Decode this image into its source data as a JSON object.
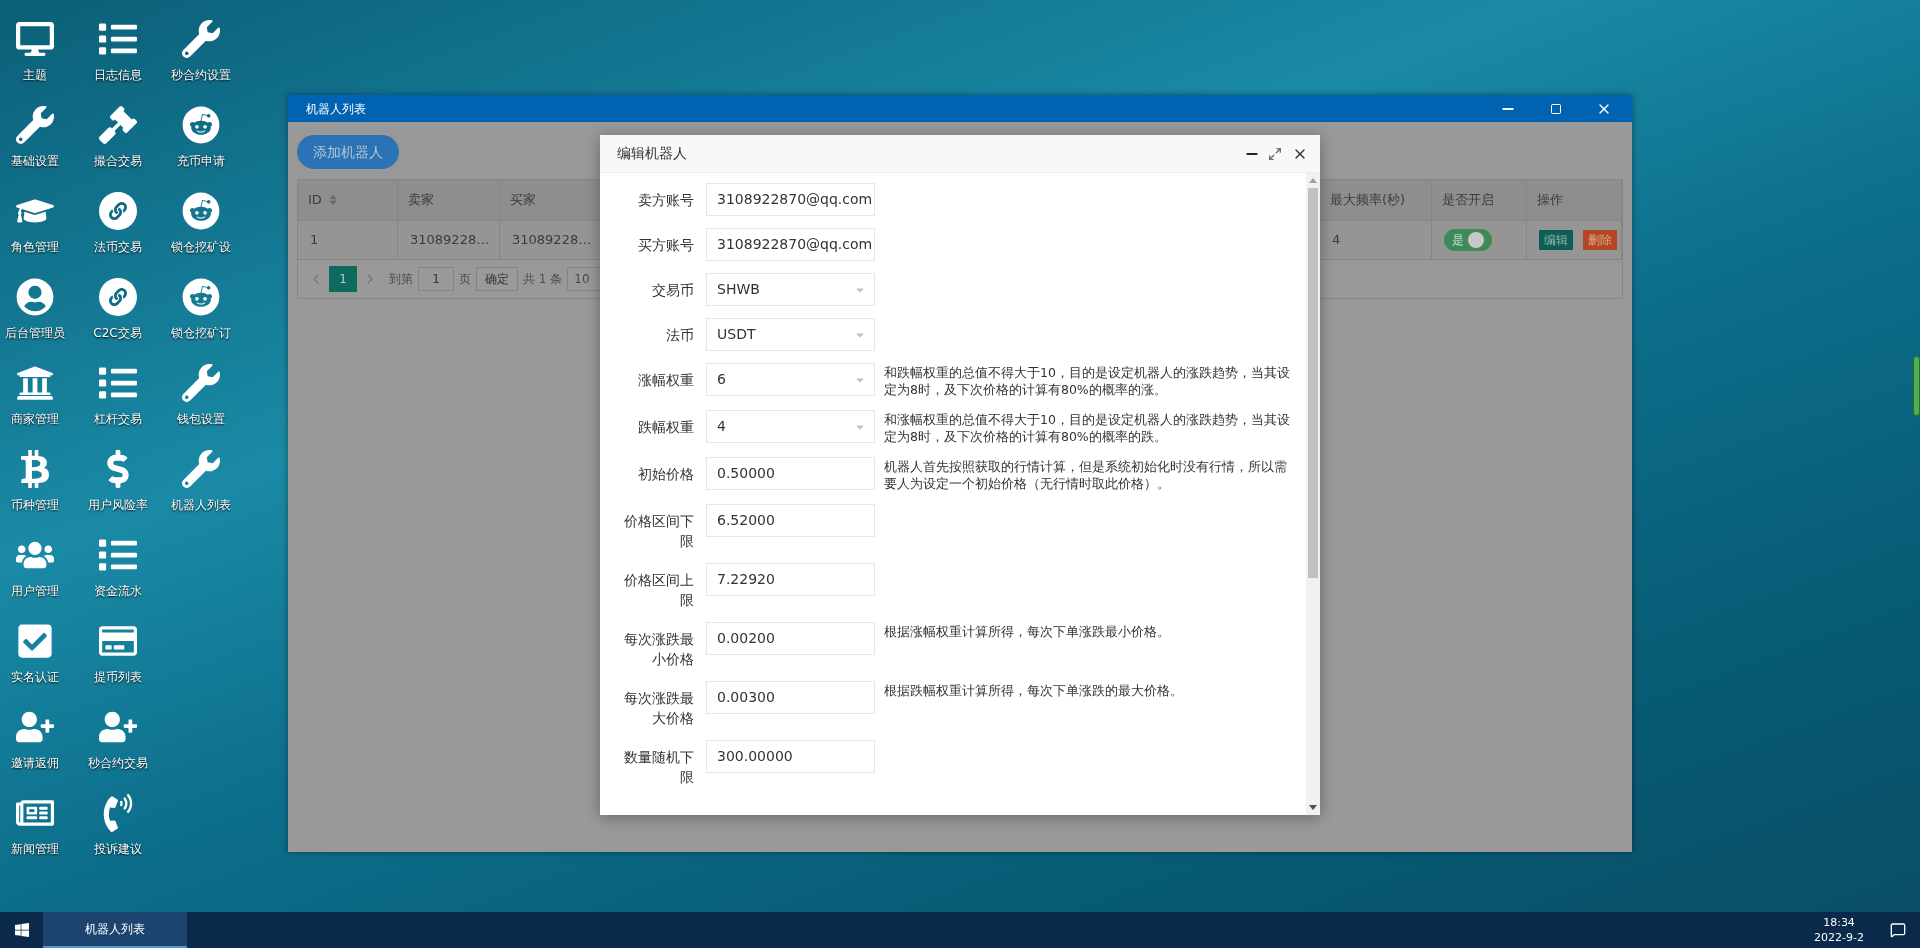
{
  "desktop": {
    "icon_columns": [
      [
        {
          "label": "主题",
          "kind": "monitor"
        },
        {
          "label": "基础设置",
          "kind": "wrench"
        },
        {
          "label": "角色管理",
          "kind": "cap"
        },
        {
          "label": "后台管理员",
          "kind": "user"
        },
        {
          "label": "商家管理",
          "kind": "bank"
        },
        {
          "label": "币种管理",
          "kind": "bitcoin"
        },
        {
          "label": "用户管理",
          "kind": "users"
        },
        {
          "label": "实名认证",
          "kind": "check"
        },
        {
          "label": "邀请返佣",
          "kind": "adduser"
        },
        {
          "label": "新闻管理",
          "kind": "news"
        }
      ],
      [
        {
          "label": "日志信息",
          "kind": "list"
        },
        {
          "label": "撮合交易",
          "kind": "gavel"
        },
        {
          "label": "法币交易",
          "kind": "link"
        },
        {
          "label": "C2C交易",
          "kind": "link"
        },
        {
          "label": "杠杆交易",
          "kind": "list"
        },
        {
          "label": "用户风险率",
          "kind": "dollar"
        },
        {
          "label": "资金流水",
          "kind": "list"
        },
        {
          "label": "提币列表",
          "kind": "card"
        },
        {
          "label": "秒合约交易",
          "kind": "adduser"
        },
        {
          "label": "投诉建议",
          "kind": "phone"
        }
      ],
      [
        {
          "label": "秒合约设置",
          "kind": "wrench"
        },
        {
          "label": "充币申请",
          "kind": "alien"
        },
        {
          "label": "锁仓挖矿设",
          "kind": "alien"
        },
        {
          "label": "锁仓挖矿订",
          "kind": "alien"
        },
        {
          "label": "钱包设置",
          "kind": "wrench"
        },
        {
          "label": "机器人列表",
          "kind": "wrench"
        }
      ]
    ]
  },
  "window": {
    "title": "机器人列表",
    "add_button": "添加机器人",
    "table": {
      "columns": [
        {
          "label": "ID",
          "sortable": true
        },
        {
          "label": "卖家",
          "sortable": false
        },
        {
          "label": "买家",
          "sortable": false
        },
        {
          "label": "最大频率(秒)",
          "sortable": false
        },
        {
          "label": "是否开启",
          "sortable": false
        },
        {
          "label": "操作",
          "sortable": false
        }
      ],
      "rows": [
        {
          "cells": [
            {
              "kind": "text",
              "text": "1"
            },
            {
              "kind": "text",
              "text": "31089228…"
            },
            {
              "kind": "text",
              "text": "31089228…"
            },
            {
              "kind": "text",
              "text": "4"
            },
            {
              "kind": "toggle",
              "label": "是",
              "on": true
            },
            {
              "kind": "actions",
              "buttons": [
                {
                  "label": "编辑",
                  "kind": "edit"
                },
                {
                  "label": "删除",
                  "kind": "delete"
                }
              ]
            }
          ]
        }
      ]
    },
    "pagination": {
      "pages": [
        {
          "label": "1",
          "selected": true
        }
      ],
      "goto_label": "到第",
      "goto_value": "1",
      "page_unit": "页",
      "confirm": "确定",
      "total": "共 1 条",
      "page_size": "10"
    }
  },
  "dialog": {
    "title": "编辑机器人",
    "fields": [
      {
        "label": "卖方账号",
        "kind": "input",
        "value": "3108922870@qq.com"
      },
      {
        "label": "买方账号",
        "kind": "input",
        "value": "3108922870@qq.com"
      },
      {
        "label": "交易币",
        "kind": "select",
        "value": "SHWB"
      },
      {
        "label": "法币",
        "kind": "select",
        "value": "USDT"
      },
      {
        "label": "涨幅权重",
        "kind": "select",
        "value": "6",
        "help": "和跌幅权重的总值不得大于10，目的是设定机器人的涨跌趋势，当其设定为8时，及下次价格的计算有80%的概率的涨。"
      },
      {
        "label": "跌幅权重",
        "kind": "select",
        "value": "4",
        "help": "和涨幅权重的总值不得大于10，目的是设定机器人的涨跌趋势，当其设定为8时，及下次价格的计算有80%的概率的跌。"
      },
      {
        "label": "初始价格",
        "kind": "input",
        "value": "0.50000",
        "help": "机器人首先按照获取的行情计算，但是系统初始化时没有行情，所以需要人为设定一个初始价格（无行情时取此价格）。"
      },
      {
        "label": "价格区间下限",
        "kind": "input",
        "value": "6.52000"
      },
      {
        "label": "价格区间上限",
        "kind": "input",
        "value": "7.22920"
      },
      {
        "label": "每次涨跌最小价格",
        "kind": "input",
        "value": "0.00200",
        "help": "根据涨幅权重计算所得，每次下单涨跌最小价格。"
      },
      {
        "label": "每次涨跌最大价格",
        "kind": "input",
        "value": "0.00300",
        "help": "根据跌幅权重计算所得，每次下单涨跌的最大价格。"
      },
      {
        "label": "数量随机下限",
        "kind": "input",
        "value": "300.00000"
      }
    ]
  },
  "taskbar": {
    "tasks": [
      {
        "label": "机器人列表",
        "selected": true
      }
    ],
    "time": "18:34",
    "date": "2022-9-2"
  }
}
